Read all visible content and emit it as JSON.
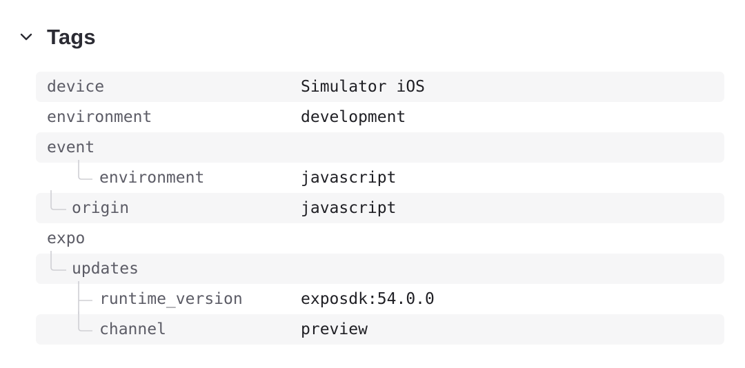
{
  "section": {
    "title": "Tags",
    "chevron_icon": "chevron-down-icon"
  },
  "colors": {
    "row_shade": "#f6f6f7",
    "key_text": "#5c5c66",
    "value_text": "#1f1f24",
    "tree_line": "#cfcfd4"
  },
  "tags": [
    {
      "key": "device",
      "value": "Simulator iOS"
    },
    {
      "key": "environment",
      "value": "development"
    },
    {
      "key": "event",
      "value": ""
    },
    {
      "key": "environment",
      "value": "javascript"
    },
    {
      "key": "origin",
      "value": "javascript"
    },
    {
      "key": "expo",
      "value": ""
    },
    {
      "key": "updates",
      "value": ""
    },
    {
      "key": "runtime_version",
      "value": "exposdk:54.0.0"
    },
    {
      "key": "channel",
      "value": "preview"
    }
  ]
}
